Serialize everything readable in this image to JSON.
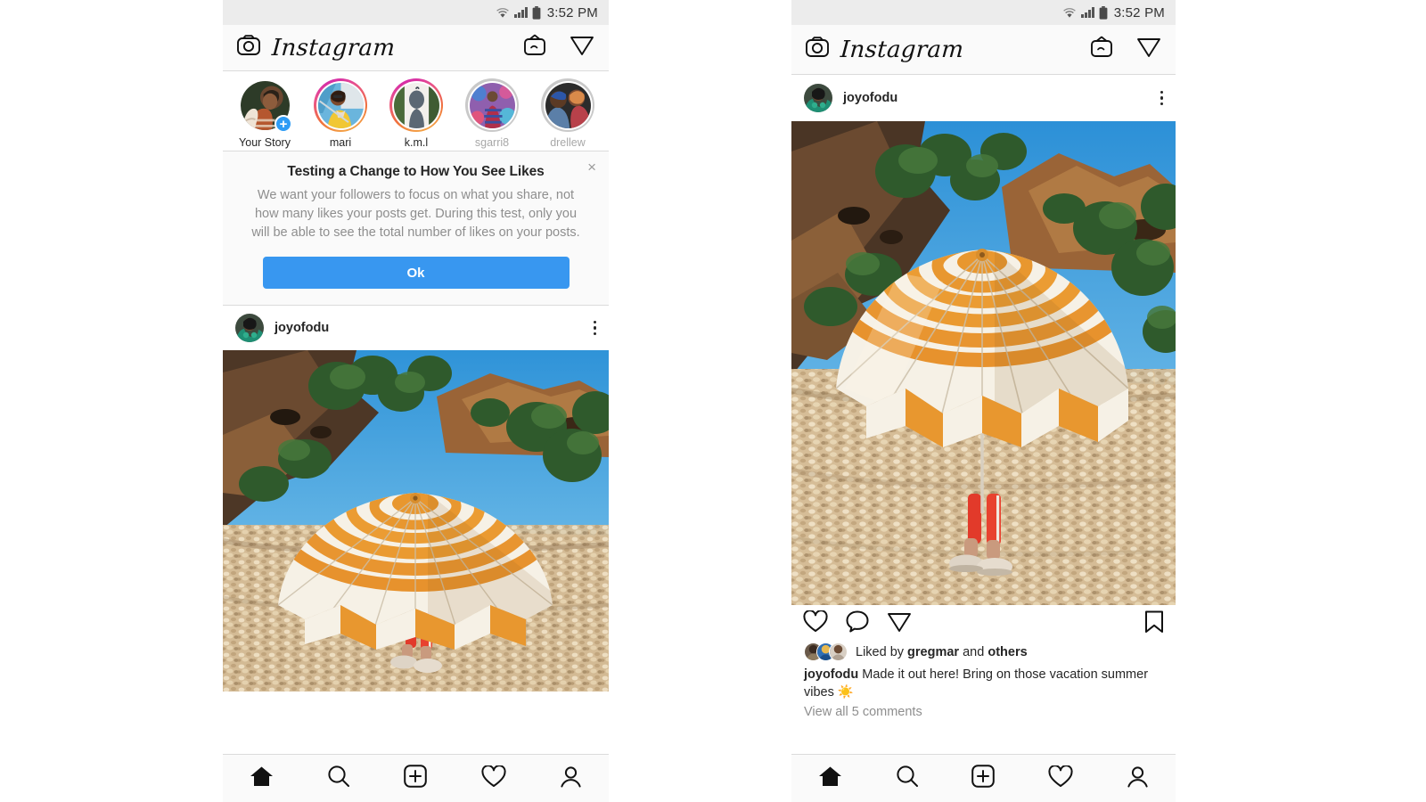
{
  "status_bar": {
    "time": "3:52 PM",
    "icons": [
      "wifi-icon",
      "cellular-signal-icon",
      "battery-icon"
    ]
  },
  "app_bar": {
    "camera_icon": "camera-icon",
    "brand": "Instagram",
    "igtv_icon": "igtv-icon",
    "direct_messages_icon": "direct-message-send-icon"
  },
  "stories": {
    "items": [
      {
        "name": "Your Story",
        "ring": "none",
        "dim": false,
        "has_add_badge": true,
        "badge": "+"
      },
      {
        "name": "mari",
        "ring": "gradient",
        "dim": false,
        "has_add_badge": false,
        "badge": ""
      },
      {
        "name": "k.m.l",
        "ring": "gradient",
        "dim": false,
        "has_add_badge": false,
        "badge": ""
      },
      {
        "name": "sgarri8",
        "ring": "seen",
        "dim": true,
        "has_add_badge": false,
        "badge": ""
      },
      {
        "name": "drellew",
        "ring": "seen",
        "dim": true,
        "has_add_badge": false,
        "badge": ""
      }
    ]
  },
  "notice": {
    "title": "Testing a Change to How You See Likes",
    "body": "We want your followers to focus on what you share, not how many likes your posts get. During this test, only you will be able to see the total number of likes on your posts.",
    "ok_label": "Ok",
    "close_label": "×",
    "button_color": "#3897f0"
  },
  "post": {
    "username": "joyofodu",
    "menu_icon": "more-options-kebab-icon",
    "actions": {
      "like_icon": "heart-icon",
      "comment_icon": "comment-bubble-icon",
      "share_icon": "share-send-icon",
      "save_icon": "bookmark-icon"
    },
    "liked_by_prefix": "Liked by",
    "liked_by_user": "gregmar",
    "liked_by_middle": "and",
    "liked_by_suffix": "others",
    "caption_text": "Made it out here! Bring on those vacation summer vibes ☀️",
    "view_comments": "View all 5 comments",
    "photo_alt": "orange-and-white-striped-beach-umbrella-on-pebble-beach"
  },
  "bottom_nav": {
    "items": [
      {
        "icon": "home-icon",
        "active": true
      },
      {
        "icon": "search-icon",
        "active": false
      },
      {
        "icon": "new-post-plus-icon",
        "active": false
      },
      {
        "icon": "activity-heart-icon",
        "active": false
      },
      {
        "icon": "profile-person-icon",
        "active": false
      }
    ]
  },
  "theme": {
    "accent": "#3897f0",
    "text": "#262626",
    "muted": "#8e8e8e",
    "border": "#dbdbdb",
    "bar_bg": "#fafafa",
    "status_bg": "#ececec"
  }
}
